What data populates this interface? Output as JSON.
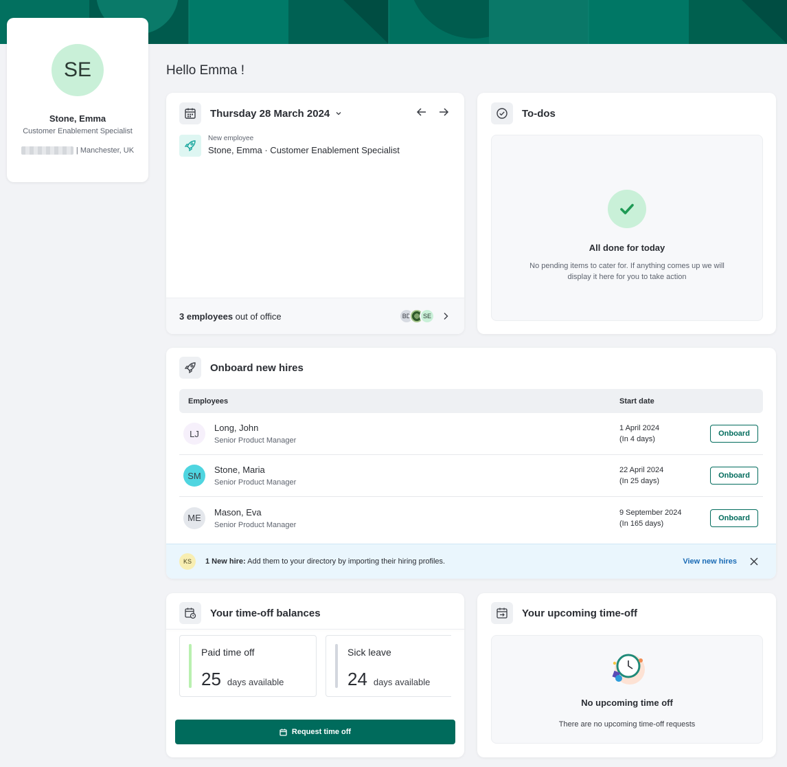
{
  "profile": {
    "initials": "SE",
    "name": "Stone, Emma",
    "role": "Customer Enablement Specialist",
    "location": "| Manchester, UK"
  },
  "greeting": "Hello Emma !",
  "calendar": {
    "date": "Thursday 28 March 2024",
    "event": {
      "tag": "New employee",
      "text": "Stone, Emma · Customer Enablement Specialist"
    },
    "ooo_count": "3 employees",
    "ooo_suffix": " out of office",
    "ooo_avatars": [
      "BD",
      "",
      "SE"
    ]
  },
  "todos": {
    "title": "To-dos",
    "empty_title": "All done for today",
    "empty_desc": "No pending items to cater for. If anything comes up we will display it here for you to take action"
  },
  "onboard": {
    "title": "Onboard new hires",
    "columns": {
      "employees": "Employees",
      "start_date": "Start date"
    },
    "rows": [
      {
        "initials": "LJ",
        "name": "Long, John",
        "role": "Senior Product Manager",
        "date": "1 April 2024",
        "relative": "(In 4 days)",
        "action": "Onboard",
        "avatar_color": "#f6f0fb"
      },
      {
        "initials": "SM",
        "name": "Stone, Maria",
        "role": "Senior Product Manager",
        "date": "22 April 2024",
        "relative": "(In 25 days)",
        "action": "Onboard",
        "avatar_color": "#4fd5e0"
      },
      {
        "initials": "ME",
        "name": "Mason, Eva",
        "role": "Senior Product Manager",
        "date": "9 September 2024",
        "relative": "(In 165 days)",
        "action": "Onboard",
        "avatar_color": "#e4e7ec"
      }
    ],
    "banner": {
      "initials": "KS",
      "bold": "1 New hire:",
      "text": " Add them to your directory by importing their hiring profiles.",
      "link": "View new hires"
    }
  },
  "balances": {
    "title": "Your time-off balances",
    "tiles": [
      {
        "name": "Paid time off",
        "value": "25",
        "unit": "days available",
        "color": "#b9f0b0"
      },
      {
        "name": "Sick leave",
        "value": "24",
        "unit": "days available",
        "color": "#d3d7de"
      }
    ],
    "request_label": "Request time off"
  },
  "upcoming": {
    "title": "Your upcoming time-off",
    "empty_title": "No upcoming time off",
    "empty_desc": "There are no upcoming time-off requests"
  },
  "colors": {
    "brand": "#006b5c",
    "link": "#1a6bb5"
  }
}
